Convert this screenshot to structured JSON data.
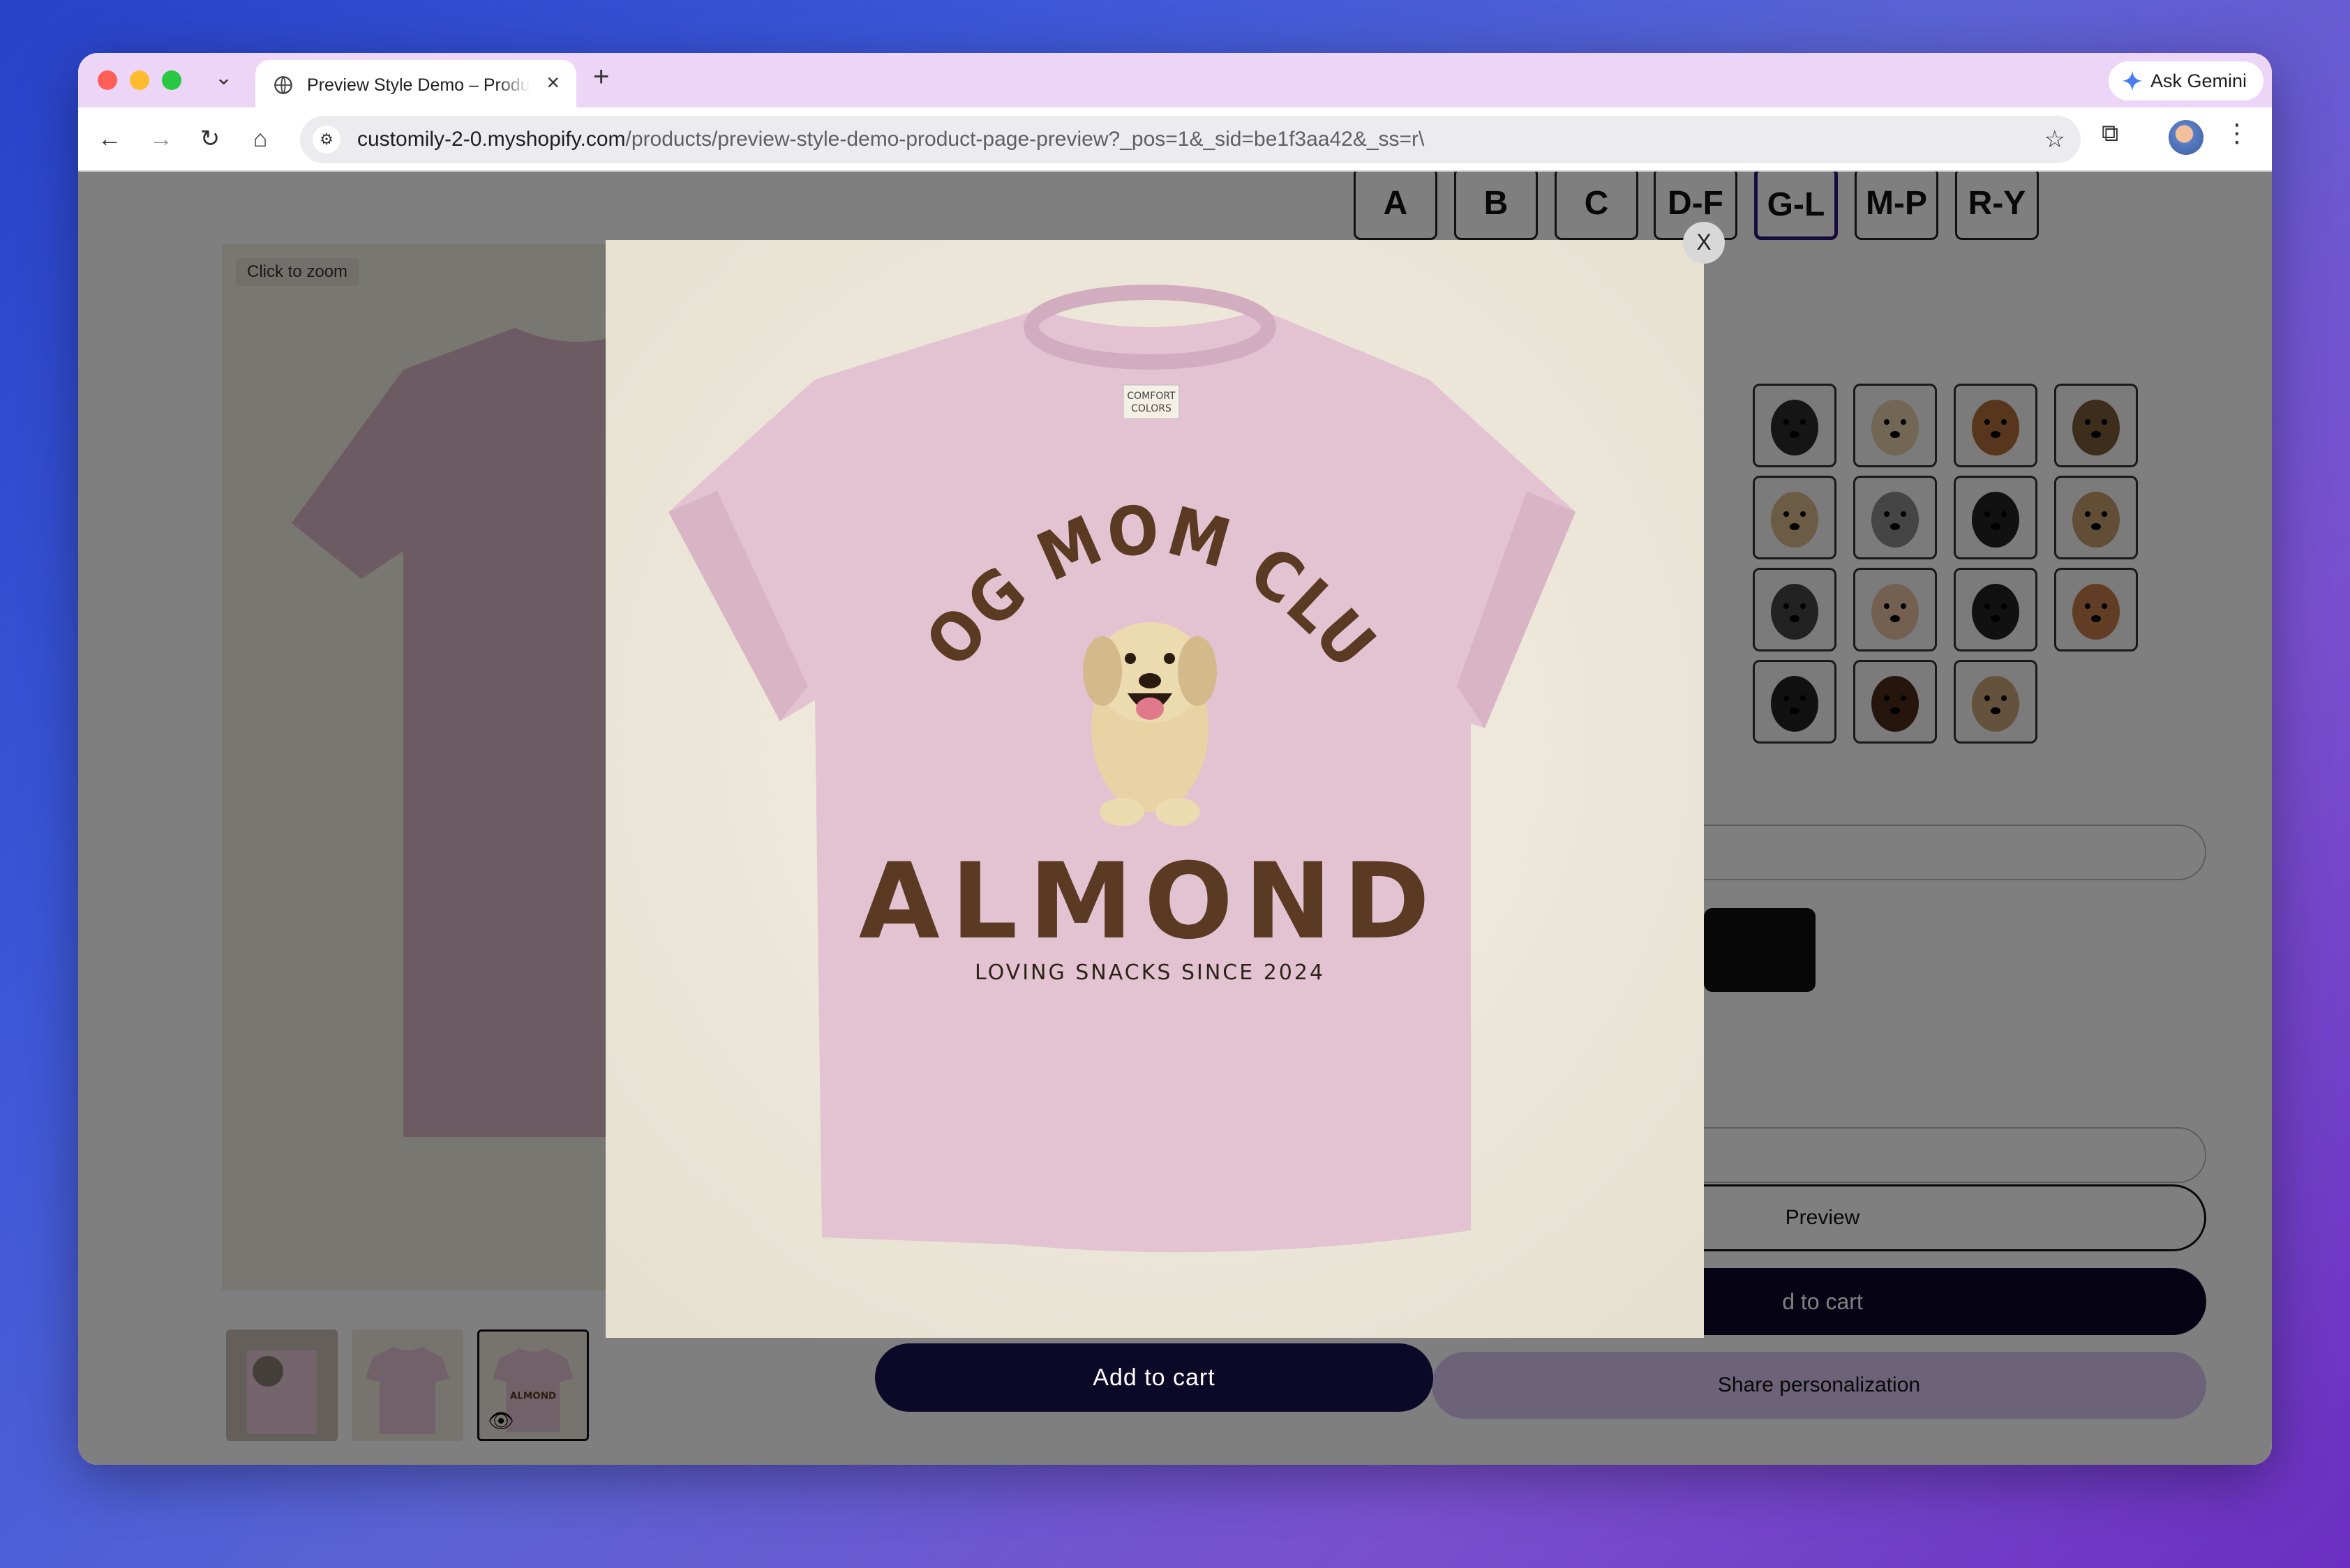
{
  "browser": {
    "tab_title": "Preview Style Demo – Product",
    "url_domain": "customily-2-0.myshopify.com",
    "url_path": "/products/preview-style-demo-product-page-preview?_pos=1&_sid=be1f3aa42&_ss=r\\",
    "gemini_label": "Ask Gemini"
  },
  "gallery": {
    "zoom_hint": "Click to zoom"
  },
  "letter_tabs": [
    "A",
    "B",
    "C",
    "D-F",
    "G-L",
    "M-P",
    "R-Y"
  ],
  "selected_letter": "G-L",
  "modal": {
    "close_label": "X",
    "shirt_heading": "DOG MOM CLUB",
    "shirt_name": "ALMOND",
    "shirt_tagline": "LOVING SNACKS SINCE 2024",
    "shirt_tag_line1": "COMFORT",
    "shirt_tag_line2": "COLORS"
  },
  "buttons": {
    "preview": "Preview",
    "add_to_cart_right": "d to cart",
    "add_to_cart_main": "Add to cart",
    "share": "Share personalization"
  },
  "icons": {
    "back": "arrow-left-icon",
    "forward": "arrow-right-icon",
    "reload": "reload-icon",
    "home": "home-icon",
    "star": "star-icon",
    "extensions": "puzzle-icon",
    "menu": "kebab-icon",
    "eye": "eye-icon"
  },
  "colors": {
    "tab_bar": "#ecd5f7",
    "cart_button": "#0c0828",
    "share_button": "#d9c6f3",
    "shirt": "#e3c3d2",
    "print": "#5a3a22"
  }
}
